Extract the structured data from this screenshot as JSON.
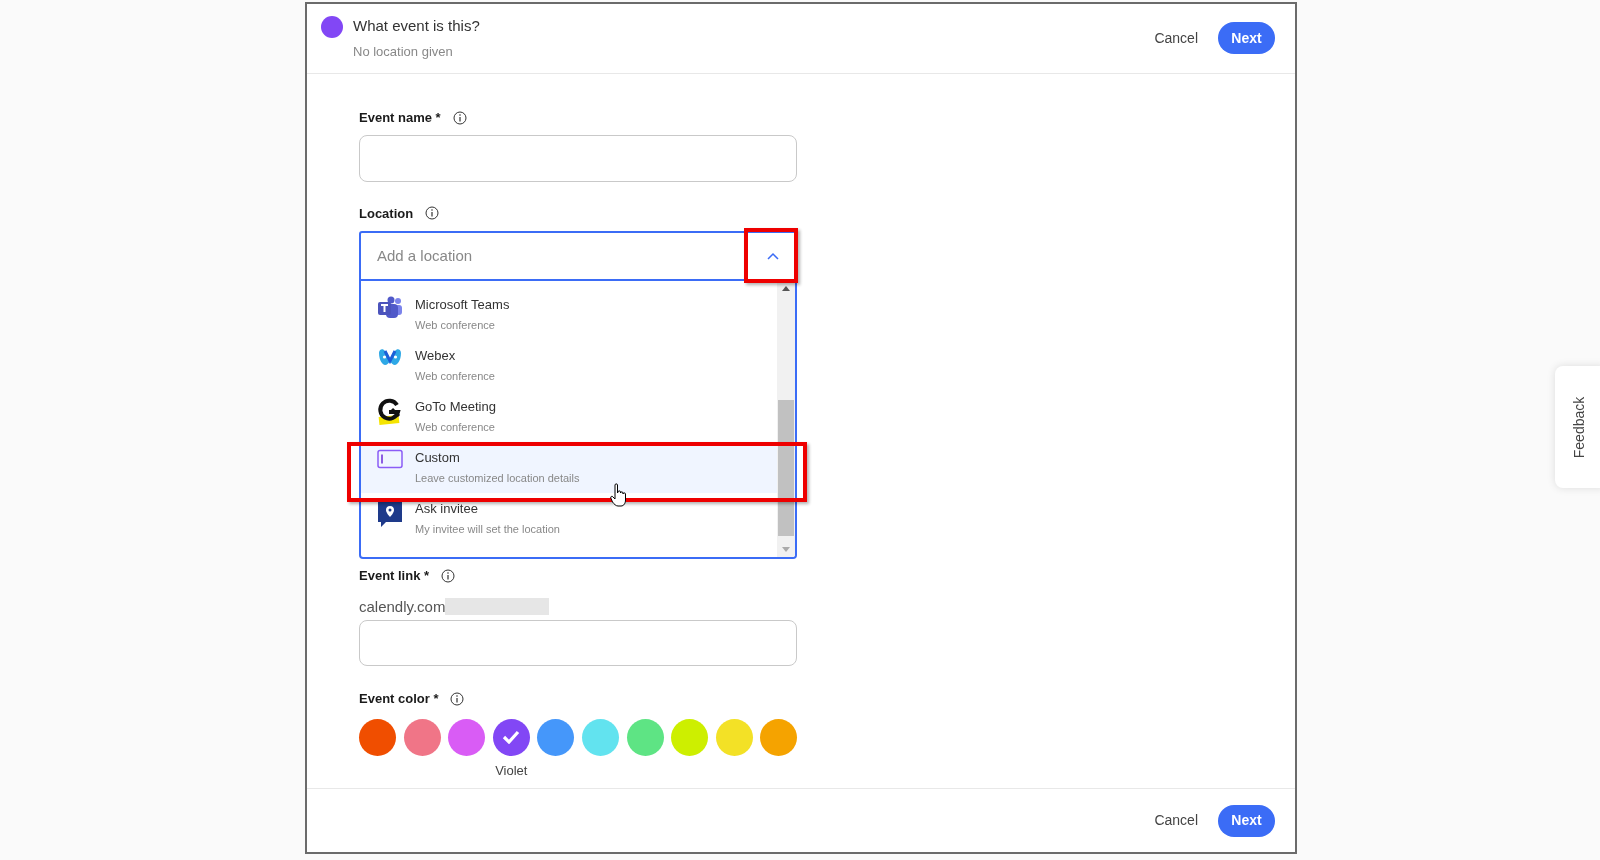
{
  "header": {
    "title": "What event is this?",
    "subtitle": "No location given",
    "cancel": "Cancel",
    "next": "Next"
  },
  "event_name": {
    "label": "Event name *"
  },
  "location": {
    "label": "Location",
    "placeholder": "Add a location",
    "expanded": true,
    "options": [
      {
        "kind": "teams",
        "title": "Microsoft Teams",
        "subtitle": "Web conference",
        "highlighted": false
      },
      {
        "kind": "webex",
        "title": "Webex",
        "subtitle": "Web conference",
        "highlighted": false
      },
      {
        "kind": "goto",
        "title": "GoTo Meeting",
        "subtitle": "Web conference",
        "highlighted": false
      },
      {
        "kind": "custom",
        "title": "Custom",
        "subtitle": "Leave customized location details",
        "highlighted": true
      },
      {
        "kind": "invitee",
        "title": "Ask invitee",
        "subtitle": "My invitee will set the location",
        "highlighted": false
      }
    ]
  },
  "event_link": {
    "label": "Event link *",
    "prefix": "calendly.com"
  },
  "event_color": {
    "label": "Event color *",
    "colors": [
      {
        "color": "#f04e00",
        "selected": false
      },
      {
        "color": "#f07587",
        "selected": false
      },
      {
        "color": "#d95cf5",
        "selected": false
      },
      {
        "color": "#8247f5",
        "selected": true,
        "name": "Violet"
      },
      {
        "color": "#4597fa",
        "selected": false
      },
      {
        "color": "#62e3ef",
        "selected": false
      },
      {
        "color": "#5ee484",
        "selected": false
      },
      {
        "color": "#cdef00",
        "selected": false
      },
      {
        "color": "#f3e126",
        "selected": false
      },
      {
        "color": "#f5a300",
        "selected": false
      }
    ]
  },
  "footer": {
    "cancel": "Cancel",
    "next": "Next"
  },
  "feedback": "Feedback"
}
